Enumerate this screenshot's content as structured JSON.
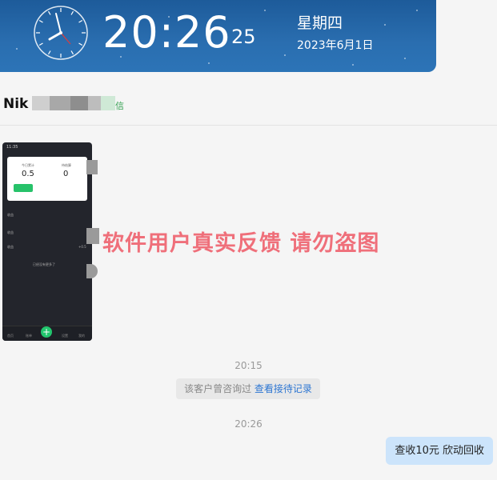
{
  "clock": {
    "time": "20:26",
    "seconds": "25",
    "weekday": "星期四",
    "date": "2023年6月1日"
  },
  "chat": {
    "contact_name": "Nik",
    "contact_tag": "信"
  },
  "shared_screenshot": {
    "status_time": "11:35",
    "label_left": "今日累计",
    "label_right": "待结算",
    "value_left": "0.5",
    "value_right": "0",
    "button_label": "提现",
    "row1": "收益",
    "row2": "收益",
    "row3": "收益",
    "row4": "+0.5",
    "footer_text": "已经没有更多了",
    "tabs": [
      "首页",
      "账单",
      "",
      "设置",
      "我的"
    ]
  },
  "watermark": "软件用户真实反馈  请勿盗图",
  "messages": [
    {
      "timestamp": "20:15"
    },
    {
      "system_text": "该客户曾咨询过",
      "system_link": "查看接待记录"
    },
    {
      "timestamp": "20:26"
    },
    {
      "bubble": "查收10元   欣动回收"
    }
  ],
  "colors": {
    "banner": "#2a6eb0",
    "watermark": "#ef6f7a",
    "link": "#2d76d2",
    "bubble": "#cce4fb"
  }
}
